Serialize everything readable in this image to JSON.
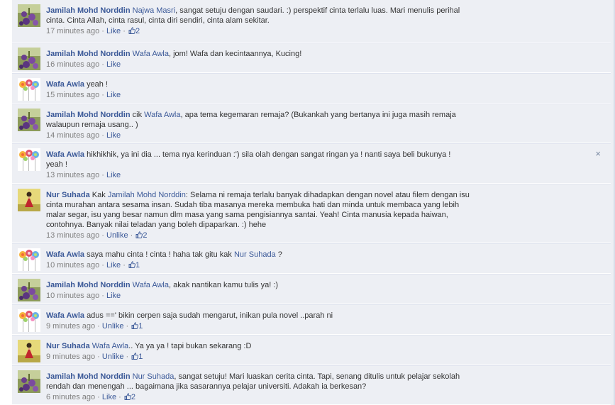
{
  "comments": [
    {
      "author": "Jamilah Mohd Norddin",
      "avatar": "purple-flowers-avatar",
      "mention": "Najwa Masri",
      "text": ", sangat setuju dengan saudari. :) perspektif cinta terlalu luas. Mari menulis perihal cinta. Cinta Allah, cinta rasul, cinta diri sendiri, cinta alam sekitar.",
      "time": "17 minutes ago",
      "action": "Like",
      "likes": "2"
    },
    {
      "author": "Jamilah Mohd Norddin",
      "avatar": "purple-flowers-avatar",
      "mention": "Wafa Awla",
      "text": ", jom! Wafa dan kecintaannya, Kucing!",
      "time": "16 minutes ago",
      "action": "Like",
      "likes": ""
    },
    {
      "author": "Wafa Awla",
      "avatar": "lollipops-avatar",
      "mention": "",
      "text": "yeah !",
      "time": "15 minutes ago",
      "action": "Like",
      "likes": ""
    },
    {
      "author": "Jamilah Mohd Norddin",
      "avatar": "purple-flowers-avatar",
      "pre": "cik ",
      "mention": "Wafa Awla",
      "text": ", apa tema kegemaran remaja? (Bukankah yang bertanya ini juga masih remaja walaupun remaja usang.. )",
      "time": "14 minutes ago",
      "action": "Like",
      "likes": ""
    },
    {
      "author": "Wafa Awla",
      "avatar": "lollipops-avatar",
      "mention": "",
      "text": "hikhikhik, ya ini dia ... tema nya kerinduan :') sila olah dengan sangat ringan ya ! nanti saya beli bukunya ! yeah !",
      "time": "13 minutes ago",
      "action": "Like",
      "likes": "",
      "close": "×"
    },
    {
      "author": "Nur Suhada",
      "avatar": "girl-photo-avatar",
      "pre": "Kak ",
      "mention": "Jamilah Mohd Norddin",
      "text": ": Selama ni remaja terlalu banyak dihadapkan dengan novel atau filem dengan isu cinta murahan antara sesama insan. Sudah tiba masanya mereka membuka hati dan minda untuk membaca yang lebih malar segar, isu yang besar namun dlm masa yang sama pengisiannya santai. Yeah! Cinta manusia kepada haiwan, contohnya. Banyak nilai teladan yang boleh dipaparkan. :) hehe",
      "time": "13 minutes ago",
      "action": "Unlike",
      "likes": "2"
    },
    {
      "author": "Wafa Awla",
      "avatar": "lollipops-avatar",
      "pre": "saya mahu cinta ! cinta ! haha tak gitu kak ",
      "mention": "Nur Suhada",
      "text": " ?",
      "time": "10 minutes ago",
      "action": "Like",
      "likes": "1"
    },
    {
      "author": "Jamilah Mohd Norddin",
      "avatar": "purple-flowers-avatar",
      "mention": "Wafa Awla",
      "text": ", akak nantikan kamu tulis ya! :)",
      "time": "10 minutes ago",
      "action": "Like",
      "likes": ""
    },
    {
      "author": "Wafa Awla",
      "avatar": "lollipops-avatar",
      "mention": "",
      "text": "adus ==' bikin cerpen saja sudah mengarut, inikan pula novel ..parah ni",
      "time": "9 minutes ago",
      "action": "Unlike",
      "likes": "1"
    },
    {
      "author": "Nur Suhada",
      "avatar": "girl-photo-avatar",
      "mention": "Wafa Awla",
      "text": ".. Ya ya ya ! tapi bukan sekarang :D",
      "time": "9 minutes ago",
      "action": "Unlike",
      "likes": "1"
    },
    {
      "author": "Jamilah Mohd Norddin",
      "avatar": "purple-flowers-avatar",
      "mention": "Nur Suhada",
      "text": ", sangat setuju! Mari luaskan cerita cinta. Tapi, senang ditulis untuk pelajar sekolah rendah dan menengah ... bagaimana jika sasarannya pelajar universiti. Adakah ia berkesan?",
      "time": "6 minutes ago",
      "action": "Like",
      "likes": "2"
    }
  ],
  "separator": " · ",
  "colors": {
    "link": "#3b5998",
    "meta": "#808080",
    "background": "#edeff4"
  }
}
